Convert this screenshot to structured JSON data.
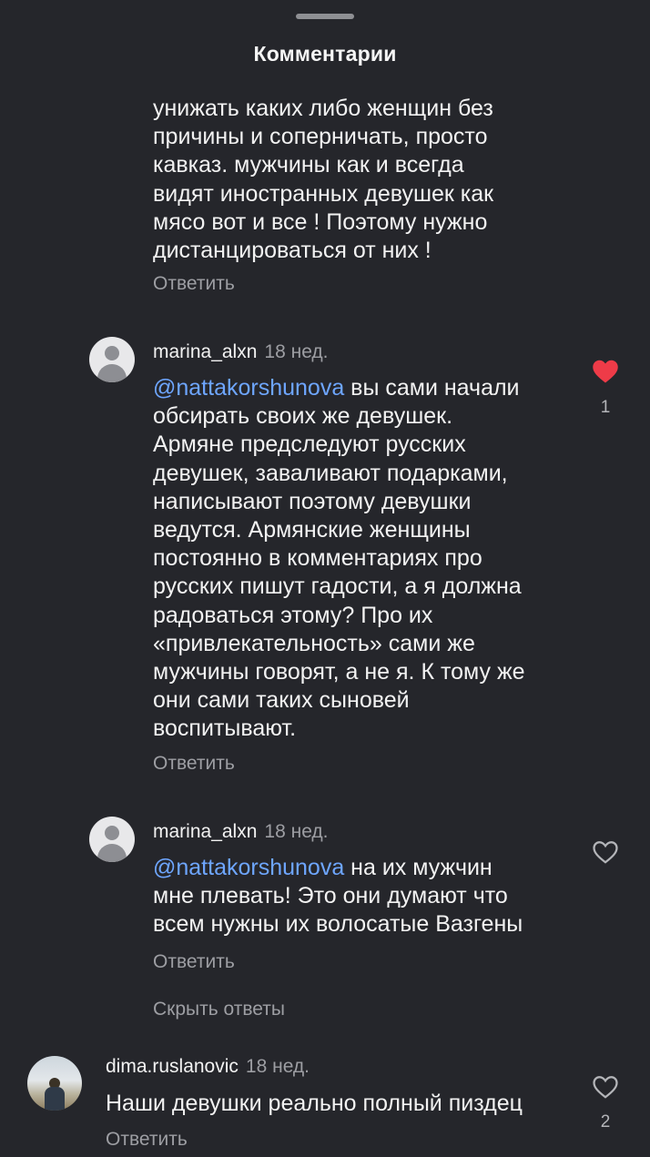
{
  "header": {
    "title": "Комментарии"
  },
  "comments": [
    {
      "text": "унижать каких либо женщин без\nпричины и соперничать, просто\nкавказ. мужчины как и всегда\nвидят иностранных девушек как\nмясо вот и все ! Поэтому нужно\nдистанцироваться от них !",
      "reply_label": "Ответить"
    },
    {
      "username": "marina_alxn",
      "time": "18 нед.",
      "mention": "@nattakorshunova",
      "text": " вы сами начали\nобсирать своих же девушек.\nАрмяне предследуют русских\nдевушек, заваливают подарками,\nнаписывают поэтому девушки\nведутся. Армянские женщины\nпостоянно в комментариях про\nрусских пишут гадости, а я должна\nрадоваться этому? Про их\n«привлекательность» сами же\nмужчины говорят, а не я. К тому же\nони сами таких сыновей\nвоспитывают.",
      "reply_label": "Ответить",
      "liked": true,
      "likes": "1",
      "heart_color": "#ee3b48"
    },
    {
      "username": "marina_alxn",
      "time": "18 нед.",
      "mention": "@nattakorshunova",
      "text": " на их мужчин\nмне плевать! Это они думают что\nвсем нужны их волосатые Вазгены",
      "reply_label": "Ответить",
      "liked": false
    },
    {
      "username": "dima.ruslanovic",
      "time": "18 нед.",
      "text": "Наши девушки реально полный пиздец",
      "reply_label": "Ответить",
      "liked": false,
      "likes": "2"
    }
  ],
  "hide_replies_label": "Скрыть ответы",
  "icons": {
    "drag_handle": "drag-handle-icon",
    "heart": "heart-icon",
    "avatar": "default-avatar-icon"
  }
}
